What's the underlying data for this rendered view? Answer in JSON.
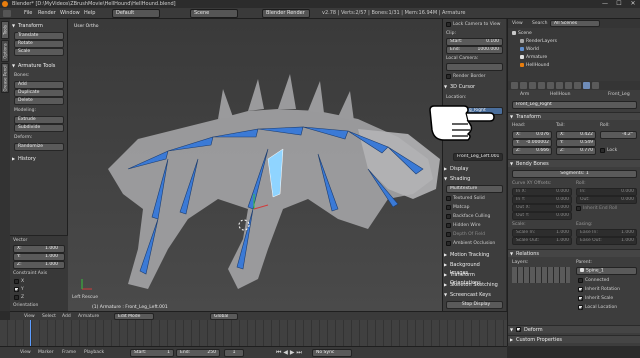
{
  "title": {
    "text": "Blender* [D:\\MyVideos\\ZBrushMovie\\HellHound\\HellHound.blend]",
    "controls": [
      "—",
      "☐",
      "✕"
    ]
  },
  "menubar": {
    "menus": [
      "File",
      "Render",
      "Window",
      "Help"
    ],
    "screen": "Default",
    "scene": "Scene",
    "engine": "Blender Render",
    "stats": "v2.78 | Verts:2/57 | Bones:1/31 | Mem:16.94M | Armature"
  },
  "vtabs": [
    "Tools",
    "Options",
    "Grease Pencil"
  ],
  "tools": {
    "transform_header": "Transform",
    "transform_buttons": [
      "Translate",
      "Rotate",
      "Scale"
    ],
    "armature_tools_header": "Armature Tools",
    "bones_label": "Bones:",
    "bones_buttons": [
      "Add",
      "Duplicate",
      "Delete"
    ],
    "modeling_label": "Modeling:",
    "modeling_buttons": [
      "Extrude",
      "Subdivide"
    ],
    "deform_label": "Deform:",
    "deform_buttons": [
      "Randomize"
    ],
    "history_header": "History"
  },
  "operator": {
    "vector_label": "Vector",
    "x_label": "X:",
    "x_value": "1.000",
    "y_label": "Y:",
    "y_value": "1.000",
    "z_label": "Z:",
    "z_value": "1.000",
    "constraint_label": "Constraint Axis",
    "axes": [
      "X",
      "Y",
      "Z"
    ],
    "orientation_label": "Orientation"
  },
  "viewport": {
    "view_label": "User Ortho",
    "corner_label": "Left Rescue",
    "status": "(1) Armature : Front_Leg_Left.001"
  },
  "npanel": {
    "lock_camera": "Lock Camera to View",
    "clip_header": "Clip:",
    "start_label": "Start:",
    "start_value": "0.100",
    "end_label": "End:",
    "end_value": "1000.000",
    "local_camera": "Local Camera:",
    "render_border": "Render Border",
    "cursor_header": "3D Cursor",
    "location_label": "Location:",
    "bone_field": "Front_Leg_Right",
    "bone_field2": "Front_Leg_Left.001",
    "display_header": "Display",
    "shading_header": "Shading",
    "shading_mode": "Multitexture",
    "shading_options": [
      "Textured Solid",
      "Matcap",
      "Backface Culling",
      "Hidden Wire",
      "Depth Of Field",
      "Ambient Occlusion"
    ],
    "motion_tracking": "Motion Tracking",
    "background_images": "Background Images",
    "transform_orientations": "Transform Orientations",
    "skeleton_sketching": "Skeleton Sketching",
    "screencast_keys": "Screencast Keys",
    "stop_display": "Stop Display"
  },
  "outliner": {
    "view": "View",
    "search": "Search",
    "filter": "All Scenes",
    "items": [
      "Scene",
      "RenderLayers",
      "World",
      "Armature",
      "HellHound"
    ]
  },
  "properties": {
    "breadcrumb": [
      "Arm",
      "HellHoun",
      "Front_Leg"
    ],
    "bone_name": "Front_Leg_Right",
    "transform_header": "Transform",
    "head_label": "Head:",
    "tail_label": "Tail:",
    "roll_label": "Roll:",
    "head": [
      "X:",
      "0.076",
      "Y:",
      "-0.000002",
      "Z:",
      "0.666"
    ],
    "tail": [
      "X:",
      "0.422",
      "Y:",
      "0.549",
      "Z:",
      "0.770"
    ],
    "roll_value": "-4.2°",
    "lock_label": "Lock",
    "bendy_header": "Bendy Bones",
    "segments_label": "Segments:",
    "segments_value": "1",
    "curve_offsets": "Curve XY Offsets:",
    "roll_sub": "Roll:",
    "in_x": "In X:",
    "in_y": "In Y:",
    "out_x": "Out X:",
    "out_y": "Out Y:",
    "in": "In:",
    "out": "Out:",
    "inherit_end_roll": "Inherit End Roll",
    "scale_label": "Scale:",
    "easing_label": "Easing:",
    "scale_in": "Scale In:",
    "scale_out": "Scale Out:",
    "ease_in": "Ease In:",
    "ease_out": "Ease Out:",
    "zero": "0.000",
    "one": "1.000",
    "relations_header": "Relations",
    "layers_label": "Layers:",
    "parent_label": "Parent:",
    "parent_value": "Spine_1",
    "connected": "Connected",
    "inherit_rotation": "Inherit Rotation",
    "inherit_scale": "Inherit Scale",
    "local_location": "Local Location",
    "deform_header": "Deform",
    "custom_props_header": "Custom Properties"
  },
  "vp_header": {
    "view": "View",
    "select": "Select",
    "add": "Add",
    "armature": "Armature",
    "mode": "Edit Mode",
    "pivot": "Global"
  },
  "timeline": {
    "view": "View",
    "marker": "Marker",
    "frame": "Frame",
    "playback": "Playback",
    "start_label": "Start:",
    "start_value": "1",
    "end_label": "End:",
    "end_value": "250",
    "current": "1",
    "sync": "No Sync"
  },
  "colors": {
    "accent": "#5680c2",
    "bone_blue": "#3b7ad6",
    "bone_select": "#8fd4ff"
  }
}
